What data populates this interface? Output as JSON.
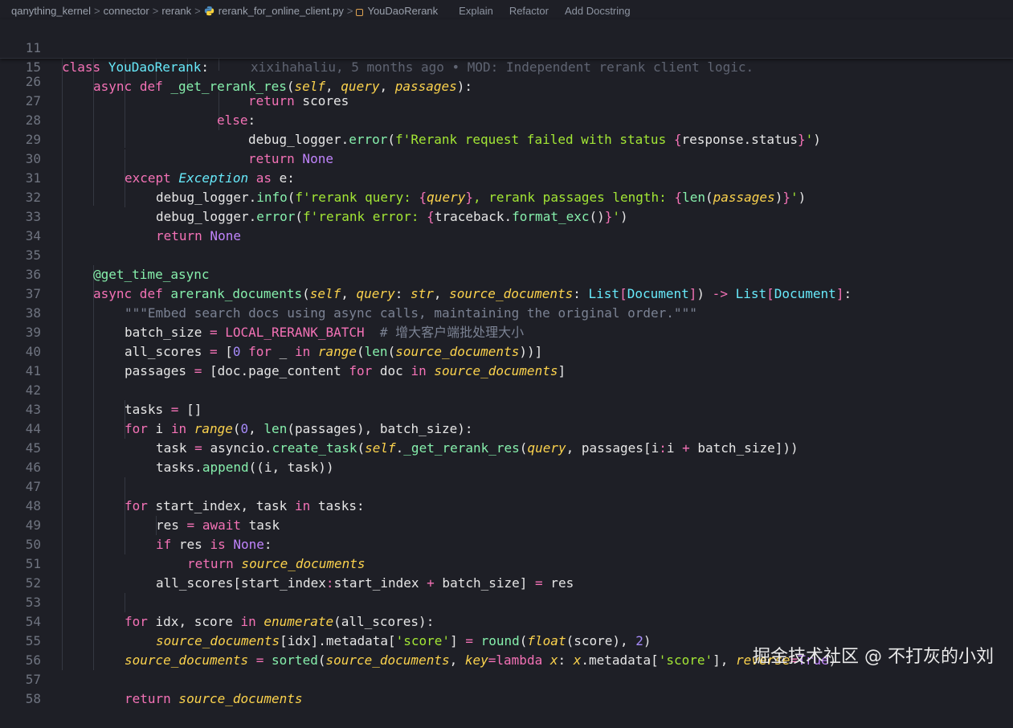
{
  "breadcrumb": {
    "items": [
      "qanything_kernel",
      "connector",
      "rerank",
      "rerank_for_online_client.py",
      "YouDaoRerank"
    ],
    "separator": ">",
    "lenses": [
      "Explain",
      "Refactor",
      "Add Docstring"
    ]
  },
  "sticky": {
    "l11_num": "11",
    "l11_kw": "class",
    "l11_name": "YouDaoRerank",
    "l11_colon": ":",
    "blame": "xixihahaliu, 5 months ago • MOD: Independent rerank client logic.",
    "l15_num": "15",
    "l15_kw1": "async",
    "l15_kw2": "def",
    "l15_fn": "_get_rerank_res",
    "l15_p1": "(",
    "l15_self": "self",
    "l15_c1": ", ",
    "l15_query": "query",
    "l15_c2": ", ",
    "l15_passages": "passages",
    "l15_end": "):"
  },
  "lines": {
    "n26": "26",
    "n27": "27",
    "n28": "28",
    "n29": "29",
    "n30": "30",
    "n31": "31",
    "n32": "32",
    "n33": "33",
    "n34": "34",
    "n35": "35",
    "n36": "36",
    "n37": "37",
    "n38": "38",
    "n39": "39",
    "n40": "40",
    "n41": "41",
    "n42": "42",
    "n43": "43",
    "n44": "44",
    "n45": "45",
    "n46": "46",
    "n47": "47",
    "n48": "48",
    "n49": "49",
    "n50": "50",
    "n51": "51",
    "n52": "52",
    "n53": "53",
    "n54": "54",
    "n55": "55",
    "n56": "56",
    "n57": "57",
    "n58": "58"
  },
  "code": {
    "l26_a": "return",
    "l26_b": " scores",
    "l27_a": "else",
    "l27_b": ":",
    "l28_a": "debug_logger",
    "l28_b": ".",
    "l28_c": "error",
    "l28_d": "(",
    "l28_e": "f'Rerank request failed with status ",
    "l28_f": "{",
    "l28_g": "response.status",
    "l28_h": "}",
    "l28_i": "'",
    "l28_j": ")",
    "l29_a": "return",
    "l29_b": " None",
    "l30_a": "except",
    "l30_b": " Exception",
    "l30_c": " as",
    "l30_d": " e",
    "l30_e": ":",
    "l31_a": "debug_logger",
    "l31_b": ".",
    "l31_c": "info",
    "l31_d": "(",
    "l31_e": "f'rerank query: ",
    "l31_f": "{",
    "l31_g": "query",
    "l31_h": "}",
    "l31_i": ", rerank passages length: ",
    "l31_j": "{",
    "l31_k": "len",
    "l31_l": "(",
    "l31_m": "passages",
    "l31_n": ")",
    "l31_o": "}",
    "l31_p": "'",
    "l31_q": ")",
    "l32_a": "debug_logger",
    "l32_b": ".",
    "l32_c": "error",
    "l32_d": "(",
    "l32_e": "f'rerank error: ",
    "l32_f": "{",
    "l32_g": "traceback",
    "l32_h": ".",
    "l32_i": "format_exc",
    "l32_j": "()",
    "l32_k": "}",
    "l32_l": "'",
    "l32_m": ")",
    "l33_a": "return",
    "l33_b": " None",
    "l35_a": "@get_time_async",
    "l36_a": "async",
    "l36_b": " def",
    "l36_c": " arerank_documents",
    "l36_d": "(",
    "l36_e": "self",
    "l36_f": ", ",
    "l36_g": "query",
    "l36_h": ": ",
    "l36_i": "str",
    "l36_j": ", ",
    "l36_k": "source_documents",
    "l36_l": ": ",
    "l36_m": "List",
    "l36_n": "[",
    "l36_o": "Document",
    "l36_p": "]",
    "l36_q": ")",
    "l36_r": " -> ",
    "l36_s": "List",
    "l36_t": "[",
    "l36_u": "Document",
    "l36_v": "]",
    "l36_w": ":",
    "l37_a": "\"\"\"Embed search docs using async calls, maintaining the original order.\"\"\"",
    "l38_a": "batch_size",
    "l38_b": " = ",
    "l38_c": "LOCAL_RERANK_BATCH",
    "l38_d": "  # 增大客户端批处理大小",
    "l39_a": "all_scores",
    "l39_b": " = ",
    "l39_c": "[",
    "l39_d": "0",
    "l39_e": " for",
    "l39_f": " _ ",
    "l39_g": "in",
    "l39_h": " range",
    "l39_i": "(",
    "l39_j": "len",
    "l39_k": "(",
    "l39_l": "source_documents",
    "l39_m": "))",
    "l39_n": "]",
    "l40_a": "passages",
    "l40_b": " = ",
    "l40_c": "[doc.page_content ",
    "l40_d": "for",
    "l40_e": " doc ",
    "l40_f": "in",
    "l40_g": " source_documents",
    "l40_h": "]",
    "l42_a": "tasks",
    "l42_b": " = ",
    "l42_c": "[]",
    "l43_a": "for",
    "l43_b": " i ",
    "l43_c": "in",
    "l43_d": " range",
    "l43_e": "(",
    "l43_f": "0",
    "l43_g": ", ",
    "l43_h": "len",
    "l43_i": "(passages), batch_size):",
    "l44_a": "task",
    "l44_b": " = ",
    "l44_c": "asyncio",
    "l44_d": ".",
    "l44_e": "create_task",
    "l44_f": "(",
    "l44_g": "self",
    "l44_h": ".",
    "l44_i": "_get_rerank_res",
    "l44_j": "(",
    "l44_k": "query",
    "l44_l": ", passages[i",
    "l44_m": ":",
    "l44_n": "i ",
    "l44_o": "+",
    "l44_p": " batch_size]))",
    "l45_a": "tasks",
    "l45_b": ".",
    "l45_c": "append",
    "l45_d": "((i, task))",
    "l47_a": "for",
    "l47_b": " start_index, task ",
    "l47_c": "in",
    "l47_d": " tasks:",
    "l48_a": "res",
    "l48_b": " = ",
    "l48_c": "await",
    "l48_d": " task",
    "l49_a": "if",
    "l49_b": " res ",
    "l49_c": "is",
    "l49_d": " None",
    "l49_e": ":",
    "l50_a": "return",
    "l50_b": " source_documents",
    "l51_a": "all_scores[start_index",
    "l51_b": ":",
    "l51_c": "start_index ",
    "l51_d": "+",
    "l51_e": " batch_size] ",
    "l51_f": "=",
    "l51_g": " res",
    "l53_a": "for",
    "l53_b": " idx, score ",
    "l53_c": "in",
    "l53_d": " enumerate",
    "l53_e": "(all_scores):",
    "l54_a": "source_documents",
    "l54_b": "[idx].metadata[",
    "l54_c": "'score'",
    "l54_d": "] ",
    "l54_e": "=",
    "l54_f": " round",
    "l54_g": "(",
    "l54_h": "float",
    "l54_i": "(score), ",
    "l54_j": "2",
    "l54_k": ")",
    "l55_a": "source_documents",
    "l55_b": " = ",
    "l55_c": "sorted",
    "l55_d": "(",
    "l55_e": "source_documents",
    "l55_f": ", ",
    "l55_g": "key",
    "l55_h": "=",
    "l55_i": "lambda",
    "l55_j": " x",
    "l55_k": ": ",
    "l55_l": "x",
    "l55_m": ".metadata[",
    "l55_n": "'score'",
    "l55_o": "], ",
    "l55_p": "reverse",
    "l55_q": "=",
    "l55_r": "True",
    "l55_s": ")",
    "l57_a": "return",
    "l57_b": " source_documents"
  },
  "watermark": "掘金技术社区 @ 不打灰的小刘"
}
